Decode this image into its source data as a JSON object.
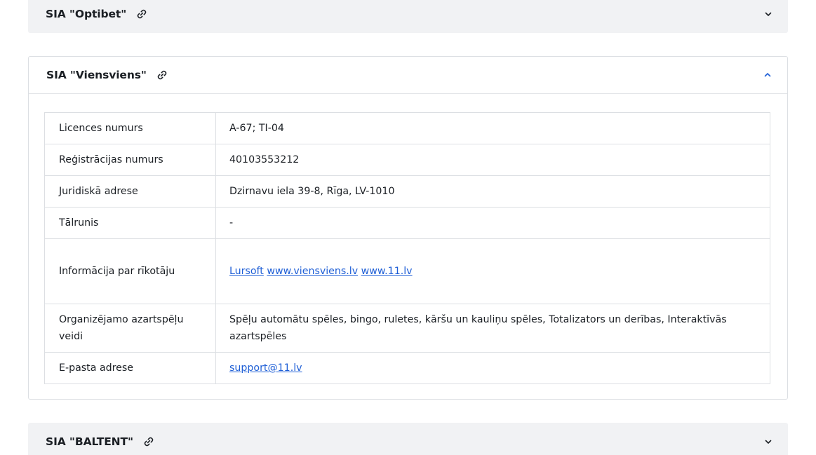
{
  "sections": {
    "top": {
      "title": "SIA \"Optibet\"",
      "link_icon": "link-icon",
      "chevron": "chevron-down-icon"
    },
    "middle": {
      "title": "SIA \"Viensviens\"",
      "link_icon": "link-icon",
      "chevron": "chevron-up-icon",
      "rows": [
        {
          "label": "Licences numurs",
          "value": "A-67; TI-04"
        },
        {
          "label": "Reģistrācijas numurs",
          "value": "40103553212"
        },
        {
          "label": "Juridiskā adrese",
          "value": "Dzirnavu iela 39-8, Rīga, LV-1010"
        },
        {
          "label": "Tālrunis",
          "value": "-"
        },
        {
          "label": "Informācija par rīkotāju",
          "links": [
            "Lursoft",
            "www.viensviens.lv",
            "www.11.lv"
          ]
        },
        {
          "label": "Organizējamo azartspēļu veidi",
          "value": "Spēļu automātu spēles, bingo, ruletes, kāršu un kauliņu spēles, Totalizators un derības, Interaktīvās azartspēles"
        },
        {
          "label": "E-pasta adrese",
          "link": "support@11.lv"
        }
      ]
    },
    "bottom": {
      "title": "SIA \"BALTENT\"",
      "link_icon": "link-icon",
      "chevron": "chevron-down-icon"
    }
  },
  "colors": {
    "collapsed_bg": "#f1f2f4",
    "border": "#dcdfe3",
    "link": "#1f5fd6",
    "accent": "#1f5fd6",
    "text": "#1b1f24"
  }
}
